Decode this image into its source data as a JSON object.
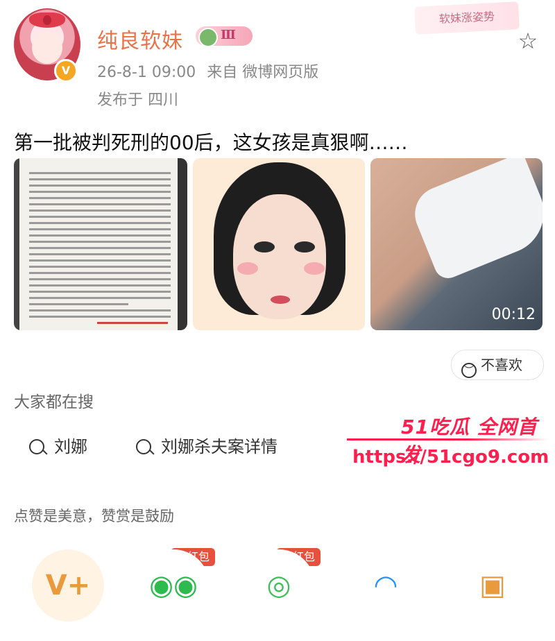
{
  "post": {
    "username": "纯良软妹",
    "level": "Ⅲ",
    "verified_icon": "V",
    "time": "26-8-1 09:00",
    "source": "来自 微博网页版",
    "location": "发布于 四川",
    "stamp": "软妹涨姿势",
    "star_icon": "☆",
    "title": "第一批被判死刑的00后，这女孩是真狠啊……",
    "video_duration": "00:12",
    "dislike_label": "不喜欢"
  },
  "search": {
    "title": "大家都在搜",
    "items": [
      "刘娜",
      "刘娜杀夫案详情"
    ]
  },
  "watermark": {
    "brand": "51吃瓜 全网首发",
    "url": "https://51cgo9.com"
  },
  "reward": {
    "text": "点赞是美意，赞赏是鼓励",
    "red_packet_label": "领红包"
  },
  "share": {
    "items": [
      {
        "icon": "vip-icon",
        "glyph": "V+",
        "color": "#e89a3c",
        "bg": "#fff3e3"
      },
      {
        "icon": "wechat-icon",
        "glyph": "◉◉",
        "color": "#2dbb4f",
        "bg": "#ffffff"
      },
      {
        "icon": "moments-icon",
        "glyph": "◎",
        "color": "#3fbf5a",
        "bg": "#ffffff"
      },
      {
        "icon": "qq-icon",
        "glyph": "◠",
        "color": "#2196f3",
        "bg": "#ffffff"
      },
      {
        "icon": "save-image-icon",
        "glyph": "▣",
        "color": "#e89a3c",
        "bg": "#ffffff"
      }
    ]
  }
}
